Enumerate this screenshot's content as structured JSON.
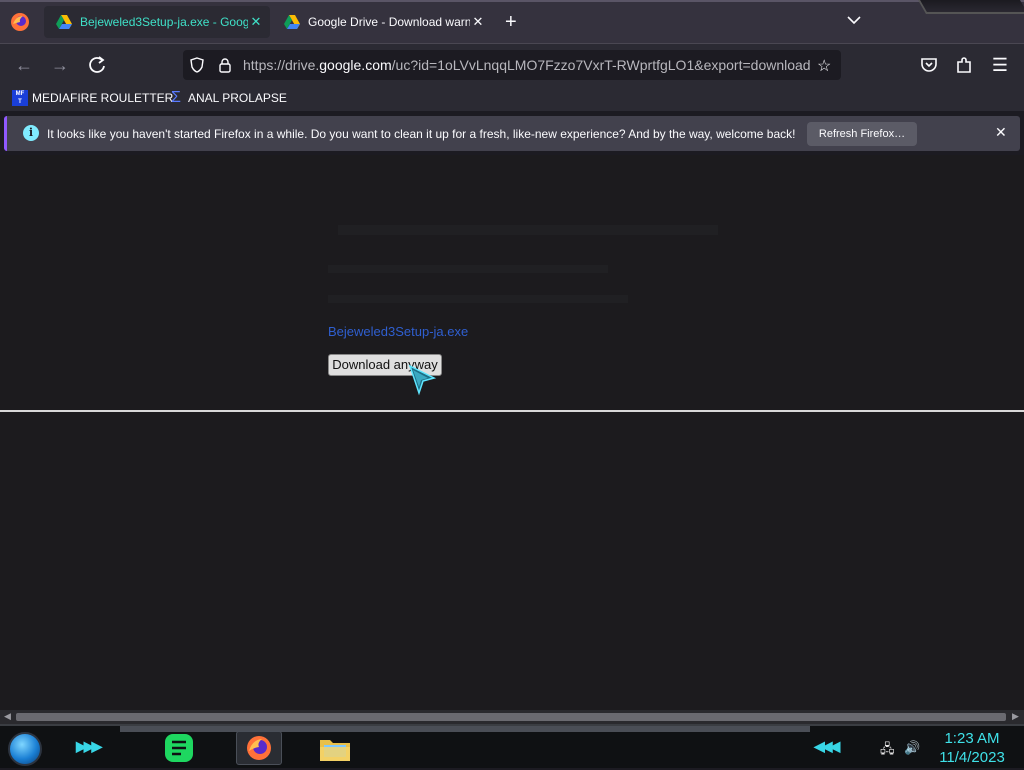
{
  "browser": {
    "tabs": [
      {
        "title": "Bejeweled3Setup-ja.exe - Googl",
        "active": true
      },
      {
        "title": "Google Drive - Download warni",
        "active": false
      }
    ],
    "url_prefix": "https://drive.",
    "url_host": "google.com",
    "url_suffix": "/uc?id=1oLVvLnqqLMO7Fzzo7VxrT-RWprtfgLO1&export=download"
  },
  "bookmarks": [
    {
      "label": "MEDIAFIRE ROULETTER",
      "icon": "mediafire-icon"
    },
    {
      "label": "ANAL PROLAPSE",
      "icon": "sigma-icon"
    }
  ],
  "notification": {
    "message": "It looks like you haven't started Firefox in a while. Do you want to clean it up for a fresh, like-new experience? And by the way, welcome back!",
    "button": "Refresh Firefox…"
  },
  "page": {
    "file_link": "Bejeweled3Setup-ja.exe",
    "download_button": "Download anyway"
  },
  "taskbar": {
    "time": "1:23 AM",
    "date": "11/4/2023"
  },
  "colors": {
    "accent": "#3fe1c8",
    "notification_stripe": "#9059ff",
    "link": "#2f5fd0",
    "clock": "#3fe1e8"
  }
}
